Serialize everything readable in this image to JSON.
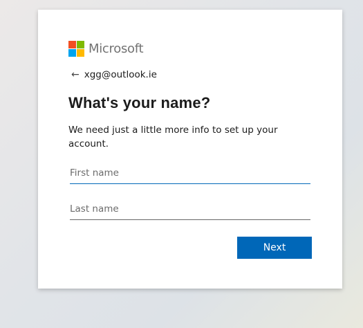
{
  "brand": {
    "name": "Microsoft",
    "logo_colors": [
      "#f25022",
      "#7fba00",
      "#00a4ef",
      "#ffb900"
    ]
  },
  "back": {
    "icon": "arrow-left-icon",
    "identity": "xgg@outlook.ie"
  },
  "heading": "What's your name?",
  "description": "We need just a little more info to set up your account.",
  "form": {
    "first_name": {
      "placeholder": "First name",
      "value": ""
    },
    "last_name": {
      "placeholder": "Last name",
      "value": ""
    }
  },
  "actions": {
    "next_label": "Next"
  },
  "colors": {
    "accent": "#0067b8",
    "text": "#1b1b1b"
  }
}
